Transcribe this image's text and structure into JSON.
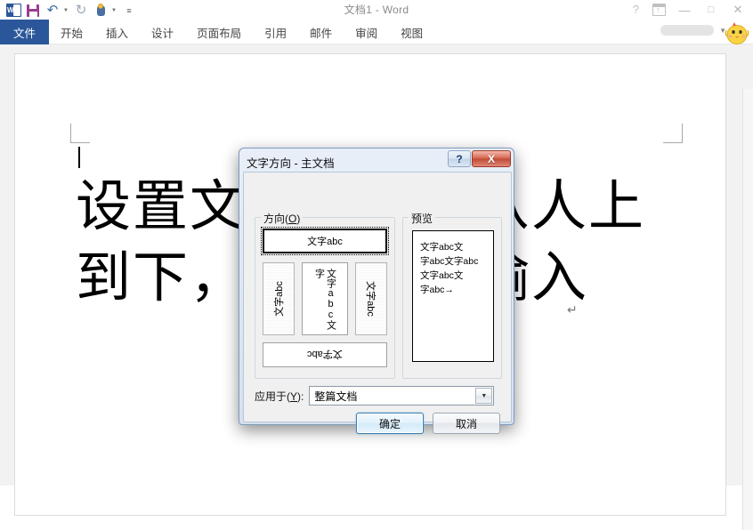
{
  "window": {
    "title": "文档1 - Word",
    "quick_access": [
      {
        "name": "word-logo",
        "label": "W"
      },
      {
        "name": "save-icon",
        "label": "保存"
      },
      {
        "name": "undo-icon",
        "label": "撤消"
      },
      {
        "name": "redo-icon",
        "label": "恢复"
      },
      {
        "name": "touch-mode-icon",
        "label": "触摸/鼠标模式"
      },
      {
        "name": "customize-qat-icon",
        "label": "自定义快速访问工具栏"
      }
    ],
    "controls": {
      "help": "?",
      "ribbon_display": "功能区显示选项",
      "minimize": "—",
      "maximize": "□",
      "close": "✕"
    }
  },
  "ribbon": {
    "tabs": [
      {
        "label": "文件",
        "active": true
      },
      {
        "label": "开始",
        "active": false
      },
      {
        "label": "插入",
        "active": false
      },
      {
        "label": "设计",
        "active": false
      },
      {
        "label": "页面布局",
        "active": false
      },
      {
        "label": "引用",
        "active": false
      },
      {
        "label": "邮件",
        "active": false
      },
      {
        "label": "审阅",
        "active": false
      },
      {
        "label": "视图",
        "active": false
      }
    ]
  },
  "document": {
    "body_text": "设置文字方向为从人上到下，从左到右输入",
    "paragraph_mark": "↵"
  },
  "dialog": {
    "title": "文字方向 - 主文档",
    "help_button": "?",
    "close_button": "X",
    "direction_group": {
      "label_prefix": "方向(",
      "label_key": "O",
      "label_suffix": ")",
      "options": [
        {
          "id": "horizontal",
          "text": "文字abc",
          "selected": true
        },
        {
          "id": "rotate-ccw-90",
          "text": "文字abc",
          "selected": false
        },
        {
          "id": "vertical-rl",
          "text_col1": "文字abc文",
          "text_col2": "字",
          "selected": false
        },
        {
          "id": "rotate-cw-90",
          "text": "文字abc",
          "selected": false
        },
        {
          "id": "rotate-180",
          "text": "文字abc",
          "selected": false
        }
      ]
    },
    "preview_group": {
      "label": "预览",
      "lines": [
        "文字abc文",
        "字abc文字abc",
        "文字abc文",
        "字abc→"
      ]
    },
    "apply_to": {
      "label_prefix": "应用于(",
      "label_key": "Y",
      "label_suffix": "):",
      "value": "整篇文档",
      "dropdown_arrow": "▼"
    },
    "buttons": {
      "ok": "确定",
      "cancel": "取消"
    }
  },
  "colors": {
    "file_tab": "#2b579a",
    "word_brand": "#2b5797",
    "dialog_close": "#c04c36",
    "accent_blue": "#3c7fb1"
  }
}
